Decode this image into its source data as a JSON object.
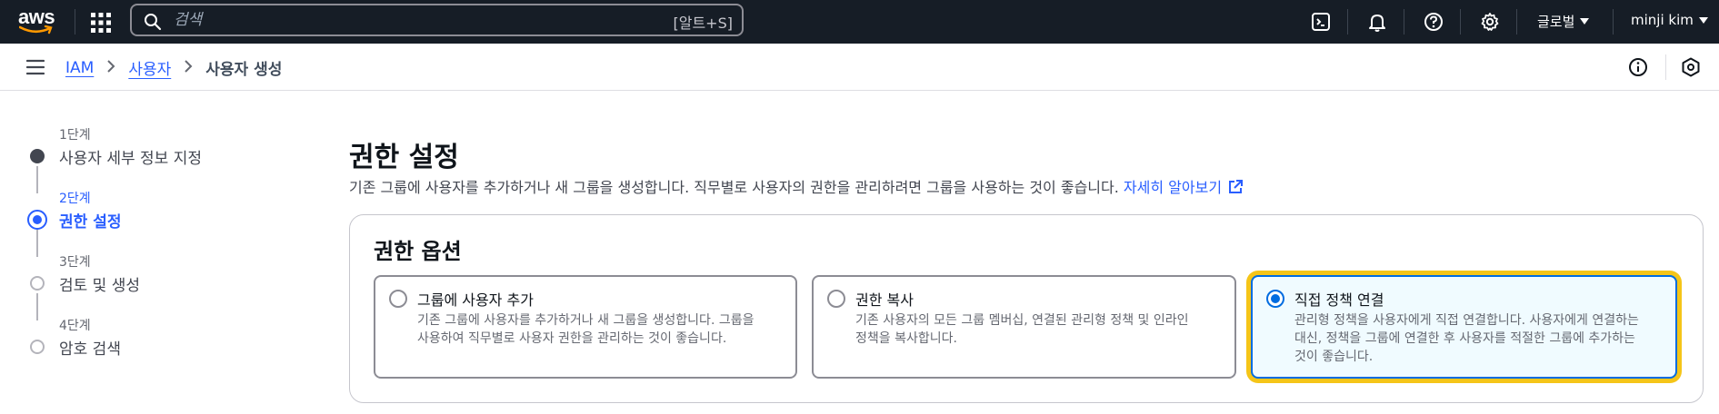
{
  "topnav": {
    "logo_text": "aws",
    "search_placeholder": "검색",
    "search_hint": "[알트+S]",
    "region_label": "글로벌",
    "user_label": "minji kim"
  },
  "breadcrumb": {
    "items": [
      "IAM",
      "사용자"
    ],
    "current": "사용자 생성"
  },
  "steps": [
    {
      "num": "1단계",
      "name": "사용자 세부 정보 지정",
      "state": "done"
    },
    {
      "num": "2단계",
      "name": "권한 설정",
      "state": "current"
    },
    {
      "num": "3단계",
      "name": "검토 및 생성",
      "state": "todo"
    },
    {
      "num": "4단계",
      "name": "암호 검색",
      "state": "todo"
    }
  ],
  "main": {
    "title": "권한 설정",
    "description": "기존 그룹에 사용자를 추가하거나 새 그룹을 생성합니다. 직무별로 사용자의 권한을 관리하려면 그룹을 사용하는 것이 좋습니다.",
    "learn_more": "자세히 알아보기"
  },
  "options_panel": {
    "title": "권한 옵션",
    "options": [
      {
        "label": "그룹에 사용자 추가",
        "desc_line1": "기존 그룹에 사용자를 추가하거나 새 그룹을 생성합니다. 그룹을",
        "desc_line2": "사용하여 직무별로 사용자 권한을 관리하는 것이 좋습니다.",
        "desc_line3": "",
        "selected": false
      },
      {
        "label": "권한 복사",
        "desc_line1": "기존 사용자의 모든 그룹 멤버십, 연결된 관리형 정책 및 인라인",
        "desc_line2": "정책을 복사합니다.",
        "desc_line3": "",
        "selected": false
      },
      {
        "label": "직접 정책 연결",
        "desc_line1": "관리형 정책을 사용자에게 직접 연결합니다. 사용자에게 연결하는",
        "desc_line2": "대신, 정책을 그룹에 연결한 후 사용자를 적절한 그룹에 추가하는",
        "desc_line3": "것이 좋습니다.",
        "selected": true
      }
    ]
  },
  "colors": {
    "nav_bg": "#161d26",
    "link": "#295eff",
    "selected_border": "#006ce0",
    "highlight": "#f5c518"
  }
}
